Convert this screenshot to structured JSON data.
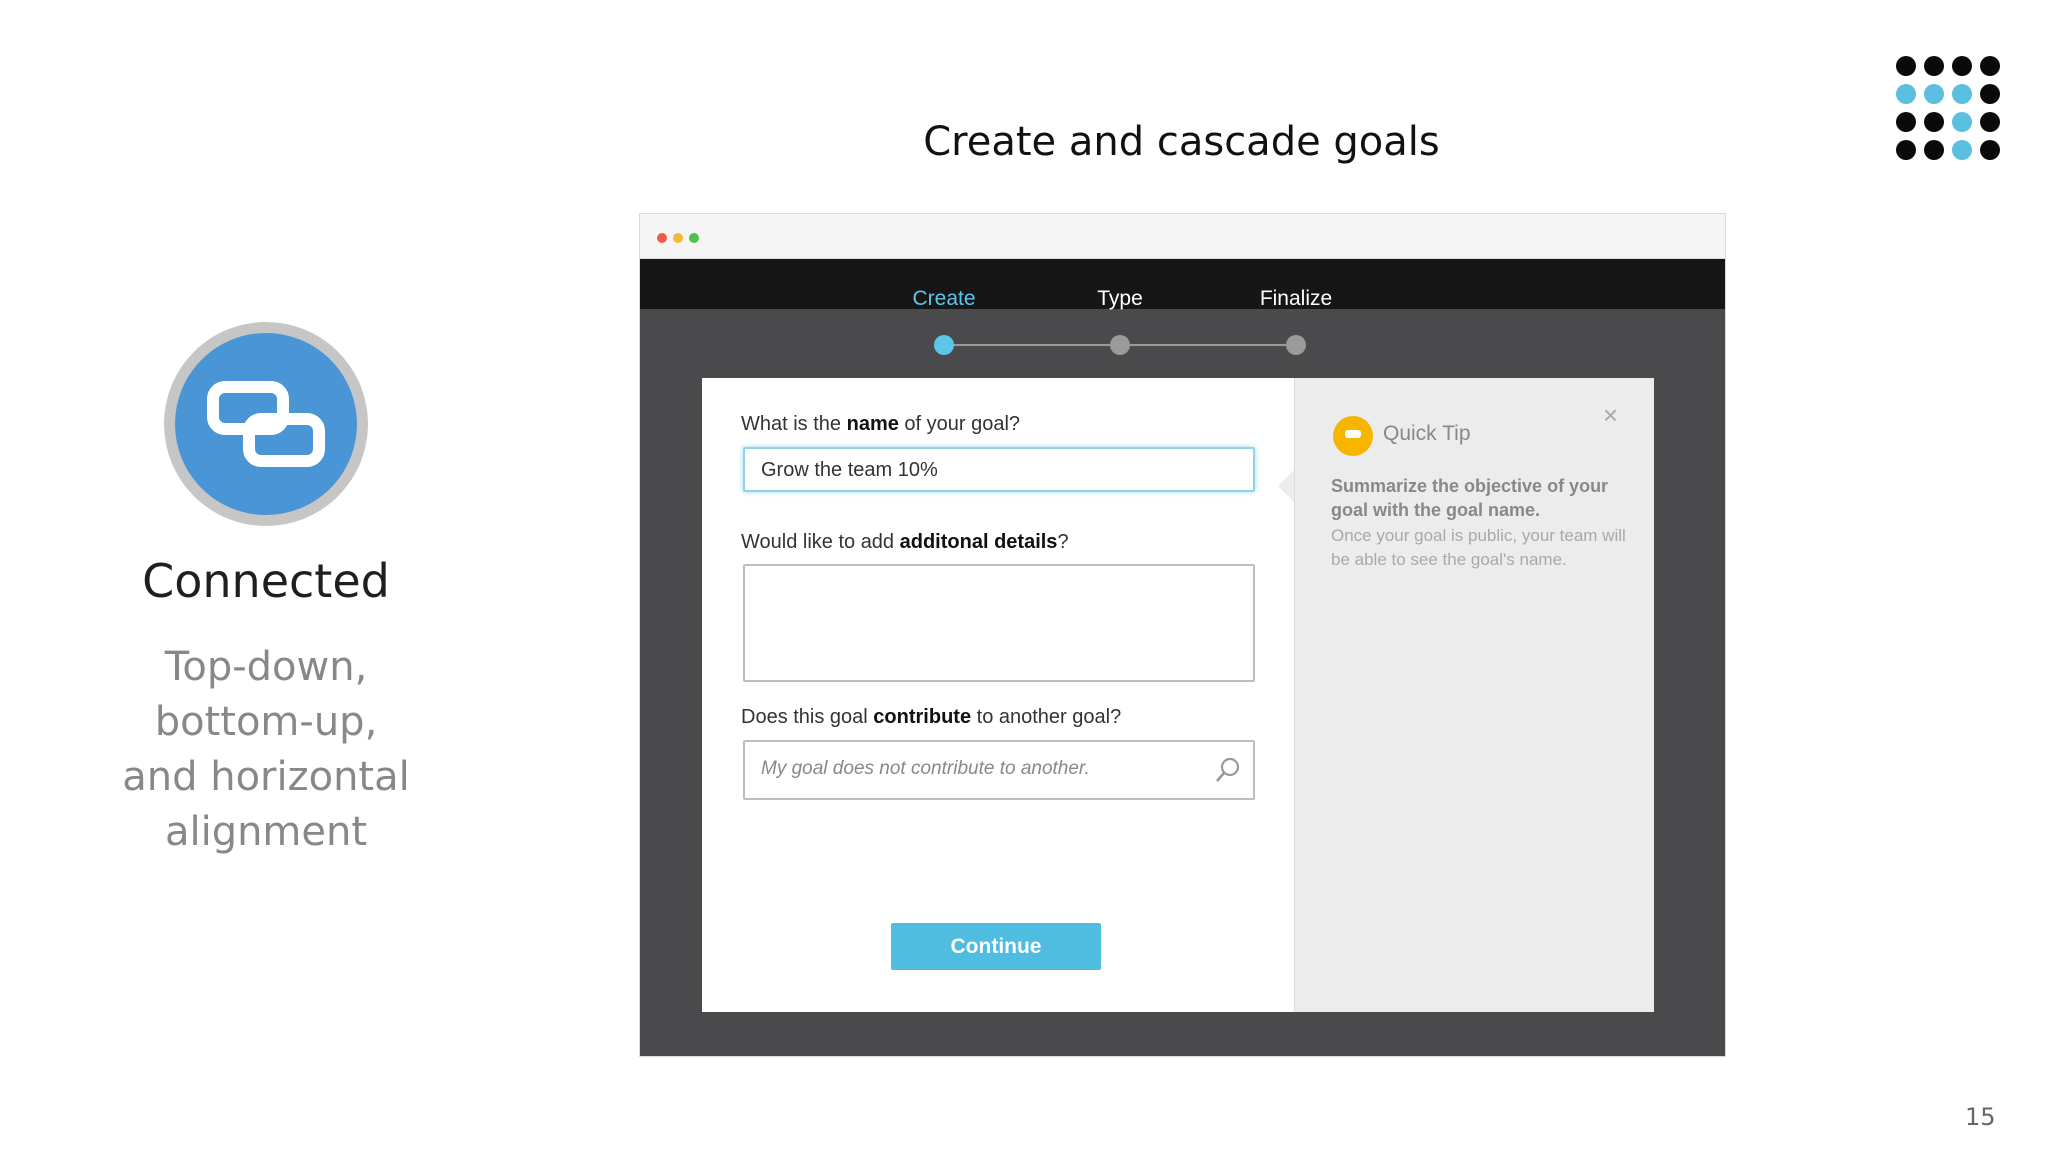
{
  "slide": {
    "title": "Create and cascade goals",
    "page_number": "15",
    "colors": {
      "accent": "#4ebde0",
      "icon_blue": "#4a95d6",
      "dot_blue": "#5bbfe0"
    }
  },
  "feature": {
    "icon": "link-chain-icon",
    "title": "Connected",
    "description_lines": [
      "Top-down,",
      "bottom-up,",
      "and horizontal",
      "alignment"
    ]
  },
  "app": {
    "steps": [
      {
        "label": "Create",
        "active": true
      },
      {
        "label": "Type",
        "active": false
      },
      {
        "label": "Finalize",
        "active": false
      }
    ],
    "form": {
      "name_question": {
        "prefix": "What is the ",
        "bold": "name",
        "suffix": " of your goal?"
      },
      "name_value": "Grow the team 10%",
      "details_question": {
        "prefix": "Would like to add ",
        "bold": "additonal details",
        "suffix": "?"
      },
      "details_value": "",
      "contribute_question": {
        "prefix": "Does this goal ",
        "bold": "contribute",
        "suffix": " to another goal?"
      },
      "contribute_placeholder": "My goal does not contribute to another.",
      "continue_label": "Continue"
    },
    "tip": {
      "title": "Quick Tip",
      "close": "×",
      "bold_text": "Summarize the objective of your goal with the goal name.",
      "body_text": "Once your goal is public, your team will be able to see the goal's name."
    }
  }
}
